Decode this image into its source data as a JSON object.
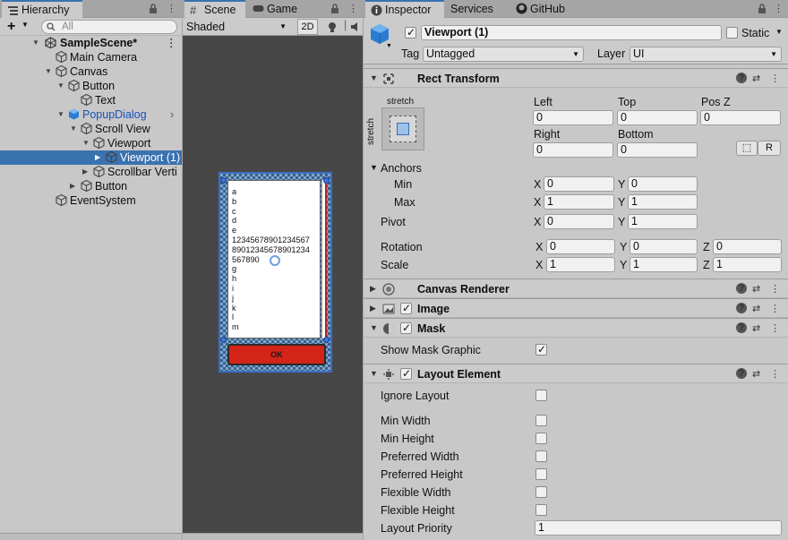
{
  "hierarchy": {
    "tab_label": "Hierarchy",
    "add_label": "+",
    "search_placeholder": "All",
    "items": [
      {
        "label": "SampleScene*",
        "depth": 0,
        "type": "scene",
        "expanded": true
      },
      {
        "label": "Main Camera",
        "depth": 1,
        "type": "gameobject"
      },
      {
        "label": "Canvas",
        "depth": 1,
        "type": "gameobject",
        "expanded": true
      },
      {
        "label": "Button",
        "depth": 2,
        "type": "gameobject",
        "expanded": true
      },
      {
        "label": "Text",
        "depth": 3,
        "type": "gameobject"
      },
      {
        "label": "PopupDialog",
        "depth": 2,
        "type": "prefab",
        "expanded": true
      },
      {
        "label": "Scroll View",
        "depth": 3,
        "type": "gameobject",
        "expanded": true
      },
      {
        "label": "Viewport",
        "depth": 4,
        "type": "gameobject",
        "expanded": true
      },
      {
        "label": "Viewport (1)",
        "depth": 5,
        "type": "gameobject",
        "selected": true
      },
      {
        "label": "Scrollbar Verti",
        "depth": 4,
        "type": "gameobject"
      },
      {
        "label": "Button",
        "depth": 3,
        "type": "gameobject"
      },
      {
        "label": "EventSystem",
        "depth": 1,
        "type": "gameobject"
      }
    ]
  },
  "scene": {
    "tabs": [
      {
        "label": "Scene",
        "active": true
      },
      {
        "label": "Game",
        "active": false
      }
    ],
    "shading_mode": "Shaded",
    "mode_2d": "2D",
    "popup": {
      "content_lines": [
        "a",
        "b",
        "c",
        "d",
        "e",
        "12345678901234567",
        "89012345678901234",
        "567890",
        "g",
        "h",
        "i",
        "j",
        "k",
        "l",
        "m"
      ],
      "ok_label": "OK"
    }
  },
  "inspector": {
    "tabs": [
      {
        "label": "Inspector",
        "active": true
      },
      {
        "label": "Services",
        "active": false
      },
      {
        "label": "GitHub",
        "active": false
      }
    ],
    "object_name": "Viewport (1)",
    "active": true,
    "static_label": "Static",
    "tag_label": "Tag",
    "tag_value": "Untagged",
    "layer_label": "Layer",
    "layer_value": "UI",
    "rect_transform": {
      "title": "Rect Transform",
      "anchor_preset_h": "stretch",
      "anchor_preset_v": "stretch",
      "left_label": "Left",
      "left": "0",
      "top_label": "Top",
      "top": "0",
      "posz_label": "Pos Z",
      "posz": "0",
      "right_label": "Right",
      "right": "0",
      "bottom_label": "Bottom",
      "bottom": "0",
      "r_button": "R",
      "anchors_label": "Anchors",
      "min_label": "Min",
      "min_x": "0",
      "min_y": "0",
      "max_label": "Max",
      "max_x": "1",
      "max_y": "1",
      "pivot_label": "Pivot",
      "pivot_x": "0",
      "pivot_y": "1",
      "rotation_label": "Rotation",
      "rot_x": "0",
      "rot_y": "0",
      "rot_z": "0",
      "scale_label": "Scale",
      "scale_x": "1",
      "scale_y": "1",
      "scale_z": "1",
      "x": "X",
      "y": "Y",
      "z": "Z"
    },
    "canvas_renderer": {
      "title": "Canvas Renderer"
    },
    "image": {
      "title": "Image",
      "enabled": true
    },
    "mask": {
      "title": "Mask",
      "enabled": true,
      "show_mask_graphic_label": "Show Mask Graphic",
      "show_mask_graphic": true
    },
    "layout_element": {
      "title": "Layout Element",
      "enabled": true,
      "ignore_layout_label": "Ignore Layout",
      "min_width_label": "Min Width",
      "min_height_label": "Min Height",
      "preferred_width_label": "Preferred Width",
      "preferred_height_label": "Preferred Height",
      "flexible_width_label": "Flexible Width",
      "flexible_height_label": "Flexible Height",
      "layout_priority_label": "Layout Priority",
      "layout_priority": "1"
    }
  },
  "colors": {
    "selection": "#3a72b0",
    "prefab_text": "#1a4fb8",
    "ok_button": "#d42417",
    "panel_bg": "#c8c8c8"
  }
}
